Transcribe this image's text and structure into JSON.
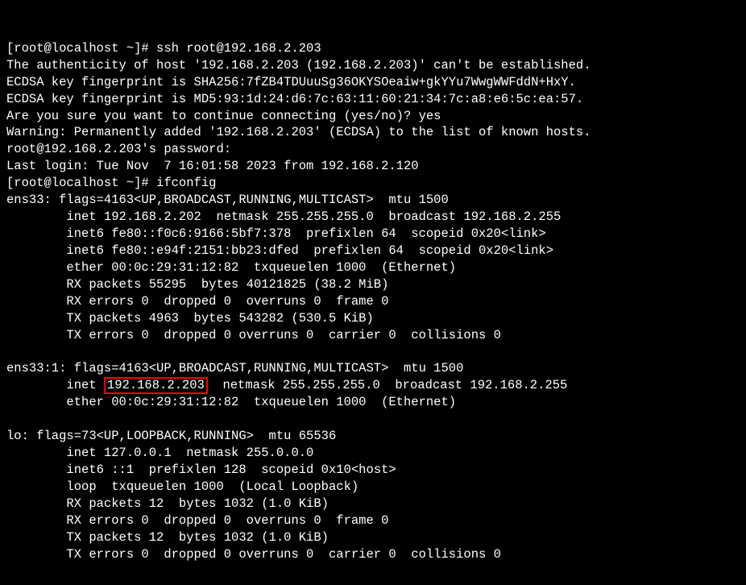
{
  "lines": {
    "l1": "[root@localhost ~]# ssh root@192.168.2.203",
    "l2": "The authenticity of host '192.168.2.203 (192.168.2.203)' can't be established.",
    "l3": "ECDSA key fingerprint is SHA256:7fZB4TDUuuSg36OKYSOeaiw+gkYYu7WwgWWFddN+HxY.",
    "l4": "ECDSA key fingerprint is MD5:93:1d:24:d6:7c:63:11:60:21:34:7c:a8:e6:5c:ea:57.",
    "l5": "Are you sure you want to continue connecting (yes/no)? yes",
    "l6": "Warning: Permanently added '192.168.2.203' (ECDSA) to the list of known hosts.",
    "l7": "root@192.168.2.203's password:",
    "l8": "Last login: Tue Nov  7 16:01:58 2023 from 192.168.2.120",
    "l9": "[root@localhost ~]# ifconfig",
    "l10": "ens33: flags=4163<UP,BROADCAST,RUNNING,MULTICAST>  mtu 1500",
    "l11": "        inet 192.168.2.202  netmask 255.255.255.0  broadcast 192.168.2.255",
    "l12": "        inet6 fe80::f0c6:9166:5bf7:378  prefixlen 64  scopeid 0x20<link>",
    "l13": "        inet6 fe80::e94f:2151:bb23:dfed  prefixlen 64  scopeid 0x20<link>",
    "l14": "        ether 00:0c:29:31:12:82  txqueuelen 1000  (Ethernet)",
    "l15": "        RX packets 55295  bytes 40121825 (38.2 MiB)",
    "l16": "        RX errors 0  dropped 0  overruns 0  frame 0",
    "l17": "        TX packets 4963  bytes 543282 (530.5 KiB)",
    "l18": "        TX errors 0  dropped 0 overruns 0  carrier 0  collisions 0",
    "l19": "",
    "l20": "ens33:1: flags=4163<UP,BROADCAST,RUNNING,MULTICAST>  mtu 1500",
    "l21a": "        inet ",
    "l21b": "192.168.2.203",
    "l21c": "  netmask 255.255.255.0  broadcast 192.168.2.255",
    "l22": "        ether 00:0c:29:31:12:82  txqueuelen 1000  (Ethernet)",
    "l23": "",
    "l24": "lo: flags=73<UP,LOOPBACK,RUNNING>  mtu 65536",
    "l25": "        inet 127.0.0.1  netmask 255.0.0.0",
    "l26": "        inet6 ::1  prefixlen 128  scopeid 0x10<host>",
    "l27": "        loop  txqueuelen 1000  (Local Loopback)",
    "l28": "        RX packets 12  bytes 1032 (1.0 KiB)",
    "l29": "        RX errors 0  dropped 0  overruns 0  frame 0",
    "l30": "        TX packets 12  bytes 1032 (1.0 KiB)",
    "l31": "        TX errors 0  dropped 0 overruns 0  carrier 0  collisions 0"
  }
}
